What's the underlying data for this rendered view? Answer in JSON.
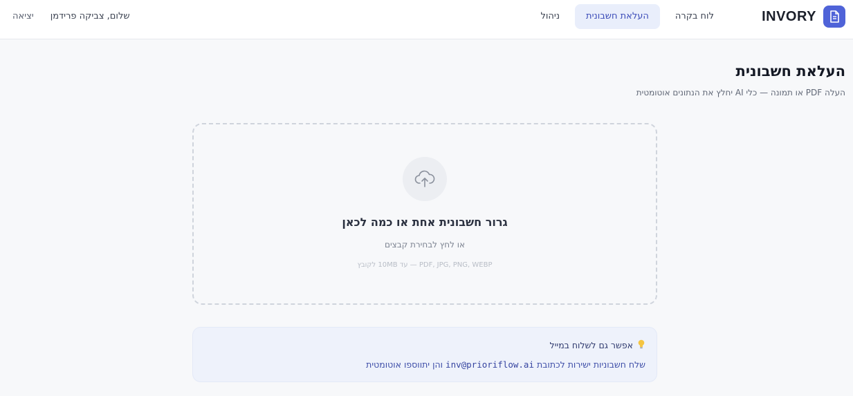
{
  "brand": {
    "name": "INVORY",
    "accent": "#4f63d8"
  },
  "nav": {
    "items": [
      {
        "label": "לוח בקרה",
        "active": false
      },
      {
        "label": "העלאת חשבונית",
        "active": true
      },
      {
        "label": "ניהול",
        "active": false
      }
    ]
  },
  "user": {
    "greeting": "שלום, צביקה פרידמן",
    "logout_label": "יציאה"
  },
  "header": {
    "title": "העלאת חשבונית",
    "subtitle": "העלה PDF או תמונה — כלי AI יחלץ את הנתונים אוטומטית"
  },
  "dropzone": {
    "icon": "cloud-upload-icon",
    "title": "גרור חשבונית אחת או כמה לכאן",
    "subtitle": "או לחץ לבחירת קבצים",
    "hint": "PDF, JPG, PNG, WEBP — עד 10MB לקובץ"
  },
  "tip": {
    "icon": "lightbulb-icon",
    "title": "אפשר גם לשלוח במייל",
    "body_before": "שלח חשבוניות ישירות לכתובת",
    "email": "inv@prioriflow.ai",
    "body_after": "והן יתווספו אוטומטית"
  }
}
